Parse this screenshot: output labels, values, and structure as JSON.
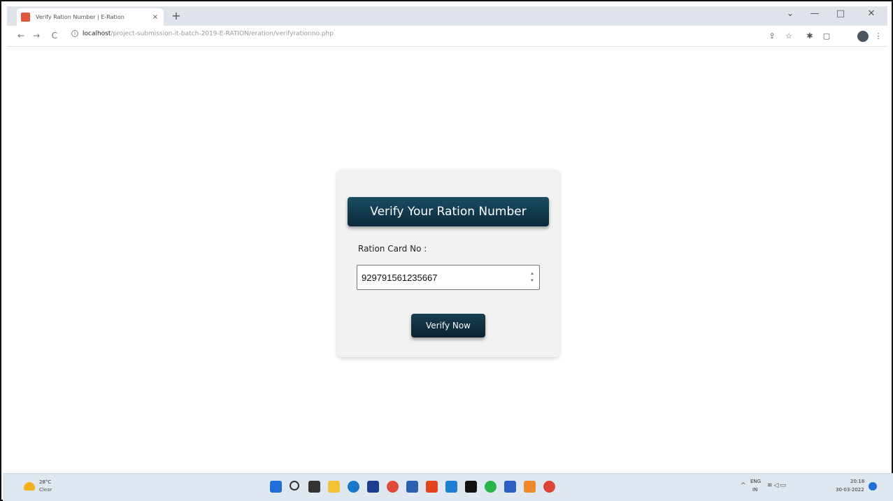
{
  "browser": {
    "tab_title": "Verify Ration Number | E-Ration",
    "tab_close": "×",
    "new_tab": "+",
    "window_controls": {
      "collapse": "⌄",
      "minimize": "—",
      "maximize": "□",
      "close": "✕"
    },
    "nav": {
      "back": "←",
      "forward": "→",
      "reload": "C"
    },
    "url_host": "localhost",
    "url_path": "/project-submission-it-batch-2019-E-RATION/eration/verifyrationno.php"
  },
  "page": {
    "heading": "Verify Your Ration Number",
    "label": "Ration Card No :",
    "input_value": "929791561235667",
    "button_label": "Verify Now"
  },
  "taskbar": {
    "weather_temp": "28°C",
    "weather_condition": "Clear",
    "lang_line1": "ENG",
    "lang_line2": "IN",
    "time": "20:18",
    "date": "30-03-2022"
  },
  "colors": {
    "accent_dark": "#0b3347",
    "card_bg": "#f2f2f2",
    "taskbar_bg": "#dfe8f0"
  }
}
